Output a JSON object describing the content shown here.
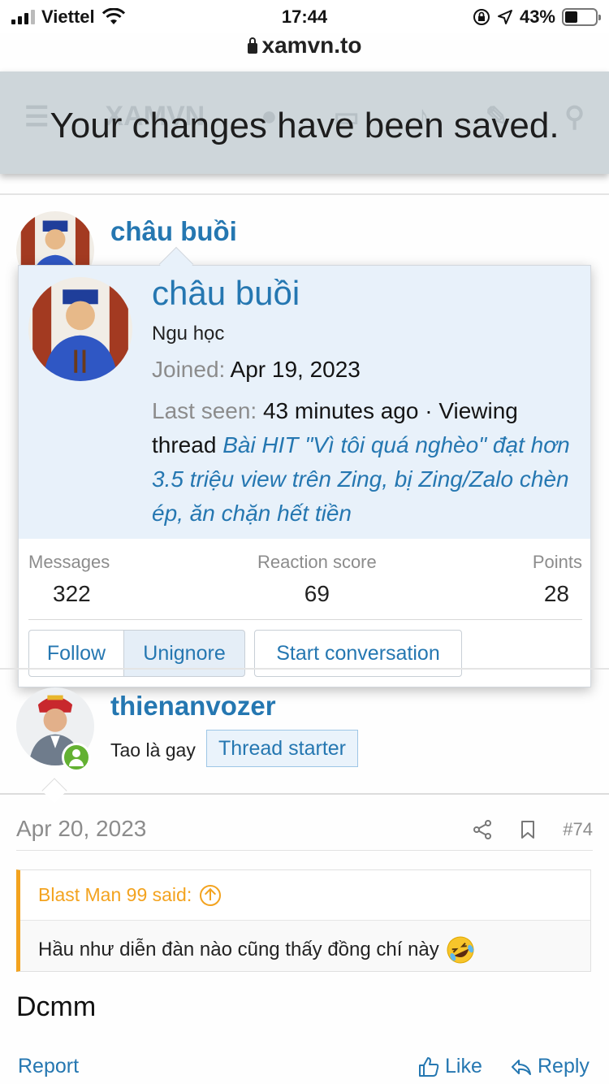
{
  "status_bar": {
    "carrier": "Viettel",
    "time": "17:44",
    "battery": "43%",
    "battery_level": 0.43,
    "url": "xamvn.to"
  },
  "header": {
    "flash_message": "Your changes have been saved.",
    "faded_logo_text": "XAMVN"
  },
  "post_author_1": {
    "name": "châu buồi"
  },
  "member_tooltip": {
    "name": "châu buồi",
    "user_title": "Ngu học",
    "joined_label": "Joined:",
    "joined_value": "Apr 19, 2023",
    "last_seen_label": "Last seen:",
    "last_seen_value": "43 minutes ago · Viewing thread",
    "thread_link": "Bài HIT \"Vì tôi quá nghèo\" đạt hơn 3.5 triệu view trên Zing, bị Zing/Zalo chèn ép, ăn chặn hết tiền",
    "stats": [
      {
        "label": "Messages",
        "value": "322"
      },
      {
        "label": "Reaction score",
        "value": "69"
      },
      {
        "label": "Points",
        "value": "28"
      }
    ],
    "buttons": {
      "follow": "Follow",
      "unignore": "Unignore",
      "start_conversation": "Start conversation"
    }
  },
  "post": {
    "author": "thienanvozer",
    "user_title": "Tao là gay",
    "starter_badge": "Thread starter",
    "date": "Apr 20, 2023",
    "post_number": "#74",
    "quote_author": "Blast Man 99 said:",
    "quote_text": "Hầu như diễn đàn nào cũng thấy đồng chí này",
    "body": "Dcmm",
    "report": "Report",
    "like": "Like",
    "reply": "Reply"
  },
  "colors": {
    "link": "#2577b1",
    "header_bg": "#ced6da",
    "tooltip_bg": "#e8f1fa",
    "quote_accent": "#f3a31f",
    "online": "#63b132"
  }
}
